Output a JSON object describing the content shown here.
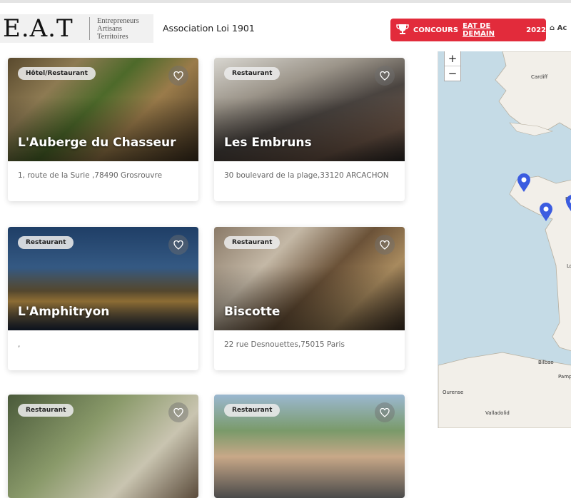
{
  "header": {
    "logo_main": "E.A.T",
    "logo_line1": "Entrepreneurs",
    "logo_line2": "Artisans",
    "logo_line3": "Territoires",
    "association": "Association Loi 1901",
    "concours_prefix": "CONCOURS",
    "concours_link": "EAT DE DEMAIN",
    "concours_year": "2022",
    "home_label": "Ac"
  },
  "cards": [
    {
      "tag": "Hôtel/Restaurant",
      "title": "L'Auberge du Chasseur",
      "address": "1, route de la Surie ,78490 Grosrouvre"
    },
    {
      "tag": "Restaurant",
      "title": "Les Embruns",
      "address": "30 boulevard de la plage,33120 ARCACHON"
    },
    {
      "tag": "Restaurant",
      "title": "L'Amphitryon",
      "address": ","
    },
    {
      "tag": "Restaurant",
      "title": "Biscotte",
      "address": "22 rue Desnouettes,75015 Paris"
    },
    {
      "tag": "Restaurant",
      "title": "",
      "address": ""
    },
    {
      "tag": "Restaurant",
      "title": "",
      "address": ""
    }
  ],
  "map": {
    "zoom_in": "+",
    "zoom_out": "−",
    "labels": [
      "Cardiff",
      "Bilbao",
      "Ourense",
      "Valladolid",
      "Re",
      "Pamp",
      "Lo"
    ],
    "marker_color": "#3b5ce0"
  }
}
